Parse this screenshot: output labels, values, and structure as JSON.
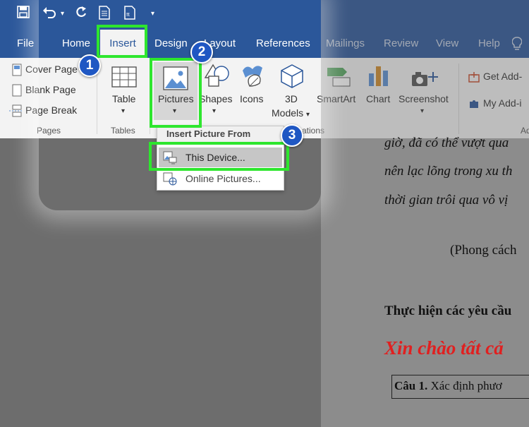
{
  "tabs": {
    "file": "File",
    "home": "Home",
    "insert": "Insert",
    "design": "Design",
    "layout": "Layout",
    "references": "References",
    "mailings": "Mailings",
    "review": "Review",
    "view": "View",
    "help": "Help"
  },
  "ribbon": {
    "pages": {
      "cover_page": "Cover Page",
      "blank_page": "Blank Page",
      "page_break": "Page Break",
      "group_label": "Pages"
    },
    "tables": {
      "table": "Table",
      "group_label": "Tables"
    },
    "illustrations": {
      "pictures": "Pictures",
      "shapes": "Shapes",
      "icons": "Icons",
      "models_3d_line1": "3D",
      "models_3d_line2": "Models",
      "group_label_partial": "ations"
    },
    "smartart": "SmartArt",
    "chart": "Chart",
    "screenshot": "Screenshot",
    "addins": {
      "get_addins": "Get Add-",
      "my_addins": "My Add-i",
      "group_label_partial": "Ad"
    }
  },
  "dropdown": {
    "header": "Insert Picture From",
    "this_device": "This Device...",
    "online_pictures": "Online Pictures..."
  },
  "document": {
    "line1": "giờ, đã có thể vượt qua",
    "line2": "nên lạc lõng trong xu th",
    "line3": "thời gian trôi qua vô vị",
    "line4": "(Phong cách",
    "line5": "Thực hiện các yêu cầu",
    "line6": "Xin chào tất cả",
    "line7_bold": "Câu 1.",
    "line7_rest": "Xác định phươ"
  },
  "badges": [
    "1",
    "2",
    "3"
  ],
  "colors": {
    "title_bar": "#2b579a",
    "highlight": "#2ee62e",
    "badge": "#1f57c3",
    "red_text": "#e02020"
  }
}
